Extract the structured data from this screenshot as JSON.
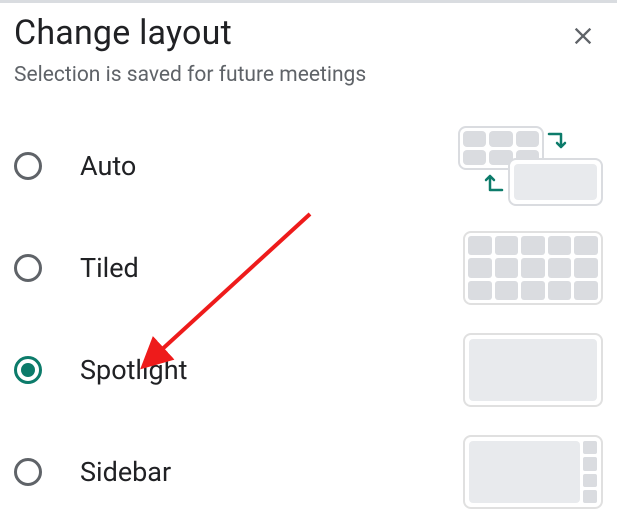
{
  "dialog": {
    "title": "Change layout",
    "subtitle": "Selection is saved for future meetings"
  },
  "options": [
    {
      "id": "auto",
      "label": "Auto",
      "selected": false
    },
    {
      "id": "tiled",
      "label": "Tiled",
      "selected": false
    },
    {
      "id": "spotlight",
      "label": "Spotlight",
      "selected": true
    },
    {
      "id": "sidebar",
      "label": "Sidebar",
      "selected": false
    }
  ],
  "annotation": {
    "type": "arrow",
    "target": "spotlight",
    "color": "#ee1b1b"
  }
}
